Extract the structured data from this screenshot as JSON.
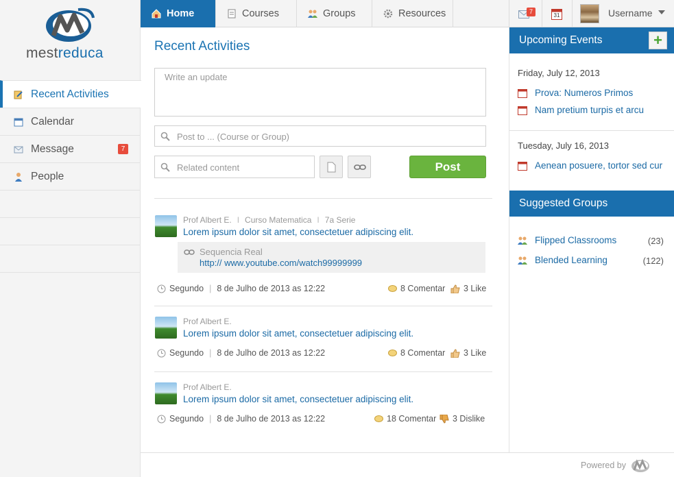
{
  "brand": {
    "name_part1": "mest",
    "name_part2": "reduca"
  },
  "sidebar": {
    "items": [
      {
        "label": "Recent Activities",
        "icon": "edit-icon"
      },
      {
        "label": "Calendar",
        "icon": "calendar-icon"
      },
      {
        "label": "Message",
        "icon": "envelope-icon",
        "badge": "7"
      },
      {
        "label": "People",
        "icon": "person-icon"
      }
    ]
  },
  "topnav": {
    "tabs": [
      {
        "label": "Home",
        "icon": "home-icon"
      },
      {
        "label": "Courses",
        "icon": "document-icon"
      },
      {
        "label": "Groups",
        "icon": "group-icon"
      },
      {
        "label": "Resources",
        "icon": "gear-icon"
      }
    ],
    "mail_badge": "7",
    "calendar_day": "31",
    "username": "Username"
  },
  "main": {
    "title": "Recent Activities",
    "update_placeholder": "Write an update",
    "post_to_placeholder": "Post to ... (Course or Group)",
    "related_placeholder": "Related content",
    "post_label": "Post",
    "posts": [
      {
        "author": "Prof Albert E.",
        "course": "Curso Matematica",
        "grade": "7a Serie",
        "text": "Lorem ipsum dolor sit amet, consectetuer adipiscing elit.",
        "attachment_title": "Sequencia Real",
        "attachment_url": "http:// www.youtube.com/watch99999999",
        "day": "Segundo",
        "date": "8 de Julho de 2013 as 12:22",
        "comments": "8 Comentar",
        "reaction": "3 Like"
      },
      {
        "author": "Prof Albert E.",
        "text": "Lorem ipsum dolor sit amet, consectetuer adipiscing elit.",
        "day": "Segundo",
        "date": "8 de Julho de 2013 as 12:22",
        "comments": "8 Comentar",
        "reaction": "3 Like"
      },
      {
        "author": "Prof Albert E.",
        "text": "Lorem ipsum dolor sit amet, consectetuer adipiscing elit.",
        "day": "Segundo",
        "date": "8 de Julho de 2013 as 12:22",
        "comments": "18 Comentar",
        "reaction": "3 Dislike"
      }
    ]
  },
  "events": {
    "title": "Upcoming Events",
    "add_label": "+",
    "days": [
      {
        "date": "Friday, July 12, 2013",
        "items": [
          "Prova: Numeros Primos",
          "Nam pretium turpis et arcu"
        ]
      },
      {
        "date": "Tuesday, July 16, 2013",
        "items": [
          "Aenean posuere, tortor sed cur"
        ]
      }
    ]
  },
  "groups": {
    "title": "Suggested Groups",
    "items": [
      {
        "name": "Flipped Classrooms",
        "count": "(23)"
      },
      {
        "name": "Blended Learning",
        "count": "(122)"
      }
    ]
  },
  "footer": {
    "powered_by": "Powered by"
  },
  "colors": {
    "accent": "#1a6fae",
    "post_button": "#6ab43e",
    "badge": "#e74c3c"
  }
}
